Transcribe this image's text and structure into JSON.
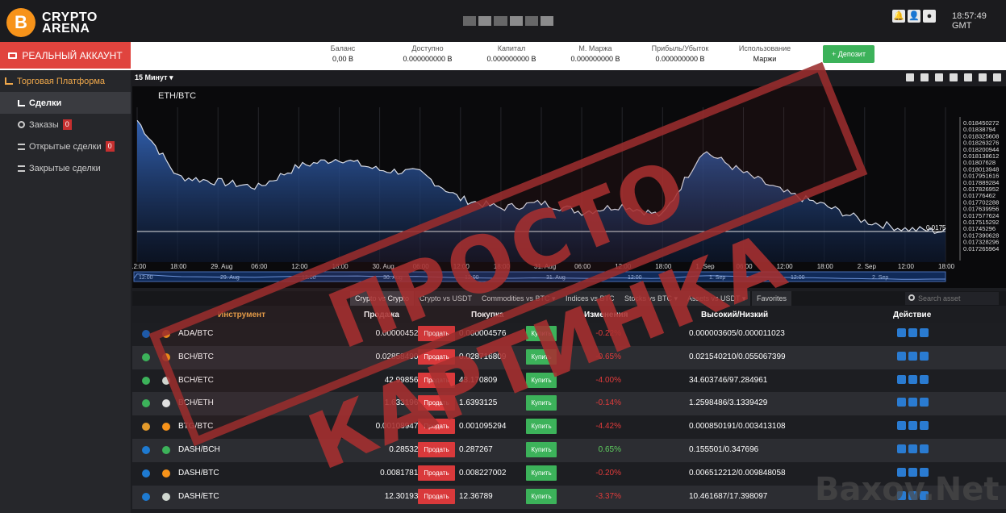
{
  "logo": {
    "coin": "B",
    "line1": "CRYPTO",
    "line2": "ARENA"
  },
  "header": {
    "clock": "18:57:49 GMT"
  },
  "account": {
    "real_button": "РЕАЛЬНЫЙ АККАУНТ",
    "stats": [
      {
        "label": "Баланс",
        "value": "0,00 B"
      },
      {
        "label": "Доступно",
        "value": "0.000000000 B"
      },
      {
        "label": "Капитал",
        "value": "0.000000000 B"
      },
      {
        "label": "М. Маржа",
        "value": "0.000000000 B"
      },
      {
        "label": "Прибыль/Убыток",
        "value": "0.000000000 B"
      },
      {
        "label": "Использование",
        "value": "Маржи"
      }
    ],
    "deposit_button": "+ Депозит"
  },
  "sidebar": {
    "platform": "Торговая Платформа",
    "items": [
      {
        "label": "Сделки",
        "badge": ""
      },
      {
        "label": "Заказы",
        "badge": "0"
      },
      {
        "label": "Открытые сделки",
        "badge": "0"
      },
      {
        "label": "Закрытые сделки",
        "badge": ""
      }
    ]
  },
  "chart": {
    "timeframe": "15 Минут ▾",
    "pair": "ETH/BTC",
    "last_price": "0.0175",
    "y_ticks": [
      "0.018450272",
      "0.01838794",
      "0.018325608",
      "0.018263276",
      "0.018200944",
      "0.018138612",
      "0.01807628",
      "0.018013948",
      "0.017951616",
      "0.017889284",
      "0.017826952",
      "0.01776462",
      "0.017702288",
      "0.017639956",
      "0.017577624",
      "0.017515292",
      "0.01745296",
      "0.017390628",
      "0.017328296",
      "0.017265964"
    ],
    "x_ticks": [
      "12:00",
      "18:00",
      "29. Aug",
      "06:00",
      "12:00",
      "18:00",
      "30. Aug",
      "06:00",
      "12:00",
      "18:00",
      "31. Aug",
      "06:00",
      "12:00",
      "18:00",
      "1. Sep",
      "06:00",
      "12:00",
      "18:00",
      "2. Sep",
      "12:00",
      "18:00"
    ],
    "nav_ticks": [
      "12:00",
      "29. Aug",
      "12:00",
      "30. Aug",
      "12:00",
      "31. Aug",
      "12:00",
      "1. Sep",
      "12:00",
      "2. Sep"
    ]
  },
  "chart_data": {
    "type": "area",
    "title": "ETH/BTC",
    "xlabel": "",
    "ylabel": "",
    "ylim": [
      0.017265964,
      0.018450272
    ],
    "x": [
      "12:00",
      "18:00",
      "29. Aug",
      "06:00",
      "12:00",
      "18:00",
      "30. Aug",
      "06:00",
      "12:00",
      "18:00",
      "31. Aug",
      "06:00",
      "12:00",
      "18:00",
      "1. Sep",
      "06:00",
      "12:00",
      "18:00",
      "2. Sep",
      "12:00",
      "18:00"
    ],
    "series": [
      {
        "values": [
          0.01835,
          0.01792,
          0.01788,
          0.01784,
          0.018,
          0.01806,
          0.01797,
          0.01795,
          0.01775,
          0.01768,
          0.01772,
          0.01765,
          0.0177,
          0.01762,
          0.01812,
          0.01795,
          0.0178,
          0.0177,
          0.01758,
          0.01752,
          0.0175
        ]
      }
    ]
  },
  "tabs": [
    {
      "label": "Crypto vs Crypto"
    },
    {
      "label": "Crypto vs USDT"
    },
    {
      "label": "Commodities vs BTC ▾"
    },
    {
      "label": "Indices vs BTC"
    },
    {
      "label": "Stocks vs BTC ▾"
    },
    {
      "label": "Assets vs USDT ▾"
    },
    {
      "label": "Favorites"
    }
  ],
  "search_placeholder": "Search asset",
  "table": {
    "headers": {
      "instrument": "Инструмент",
      "sell": "Продажа",
      "buy": "Покупка",
      "change": "Изменения",
      "highlow": "Высокий/Низкий",
      "action": "Действие"
    },
    "sell_button": "Продать",
    "buy_button": "Купить",
    "rows": [
      {
        "symbol": "ADA/BTC",
        "sell": "0.000004526",
        "buy": "0.000004576",
        "change": "-0.22%",
        "highlow": "0.000003605/0.000011023",
        "c1": "#1e5aa8",
        "c2": "#f7931a",
        "chg_color": "#e23b3b"
      },
      {
        "symbol": "BCH/BTC",
        "sell": "0.028584902",
        "buy": "0.028716809",
        "change": "-0.65%",
        "highlow": "0.021540210/0.055067399",
        "c1": "#3cb25a",
        "c2": "#f7931a",
        "chg_color": "#e23b3b"
      },
      {
        "symbol": "BCH/ETC",
        "sell": "42.998565",
        "buy": "43.170809",
        "change": "-4.00%",
        "highlow": "34.603746/97.284961",
        "c1": "#3cb25a",
        "c2": "#cfd6cf",
        "chg_color": "#e23b3b"
      },
      {
        "symbol": "BCH/ETH",
        "sell": "1.6331966",
        "buy": "1.6393125",
        "change": "-0.14%",
        "highlow": "1.2598486/3.1339429",
        "c1": "#3cb25a",
        "c2": "#e0e0e0",
        "chg_color": "#e23b3b"
      },
      {
        "symbol": "BTG/BTC",
        "sell": "0.001089471",
        "buy": "0.001095294",
        "change": "-4.42%",
        "highlow": "0.000850191/0.003413108",
        "c1": "#e39a2b",
        "c2": "#f7931a",
        "chg_color": "#e23b3b"
      },
      {
        "symbol": "DASH/BCH",
        "sell": "0.285325",
        "buy": "0.287267",
        "change": "0.65%",
        "highlow": "0.155501/0.347696",
        "c1": "#1e7ad1",
        "c2": "#3cb25a",
        "chg_color": "#5fcf5f"
      },
      {
        "symbol": "DASH/BTC",
        "sell": "0.00817817",
        "buy": "0.008227002",
        "change": "-0.20%",
        "highlow": "0.006512212/0.009848058",
        "c1": "#1e7ad1",
        "c2": "#f7931a",
        "chg_color": "#e23b3b"
      },
      {
        "symbol": "DASH/ETC",
        "sell": "12.301933",
        "buy": "12.36789",
        "change": "-3.37%",
        "highlow": "10.461687/17.398097",
        "c1": "#1e7ad1",
        "c2": "#cfd6cf",
        "chg_color": "#e23b3b"
      }
    ]
  },
  "watermark": {
    "stamp": "ПРОСТО КАРТИНКА",
    "site": "Baxov.Net"
  }
}
